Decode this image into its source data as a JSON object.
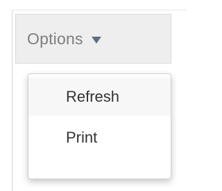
{
  "options_button": {
    "label": "Options",
    "icon": "caret-down-icon"
  },
  "dropdown": {
    "items": [
      {
        "label": "Refresh"
      },
      {
        "label": "Print"
      }
    ]
  },
  "colors": {
    "button_bg": "#eeeeee",
    "button_text": "#7e7e7e",
    "caret": "#5f6f83",
    "menu_bg": "#ffffff",
    "menu_text": "#333333",
    "menu_hover": "#f7f7f7"
  }
}
